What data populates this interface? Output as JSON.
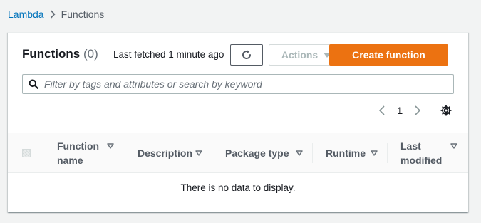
{
  "breadcrumb": {
    "root": "Lambda",
    "current": "Functions"
  },
  "panel": {
    "title": "Functions",
    "count": "(0)",
    "last_fetched": "Last fetched 1 minute ago",
    "refresh_icon": "refresh-icon",
    "actions_label": "Actions",
    "create_label": "Create function",
    "search_placeholder": "Filter by tags and attributes or search by keyword",
    "search_value": ""
  },
  "pagination": {
    "current_page": "1"
  },
  "table": {
    "columns": [
      {
        "line1": "Function",
        "line2": "name"
      },
      {
        "line1": "Description"
      },
      {
        "line1": "Package type"
      },
      {
        "line1": "Runtime"
      },
      {
        "line1": "Last",
        "line2": "modified"
      }
    ],
    "empty_message": "There is no data to display."
  },
  "colors": {
    "link": "#0073bb",
    "primary": "#ec7211",
    "text": "#16191f",
    "muted": "#687078",
    "disabled": "#aab7b8",
    "background": "#f2f3f3"
  }
}
